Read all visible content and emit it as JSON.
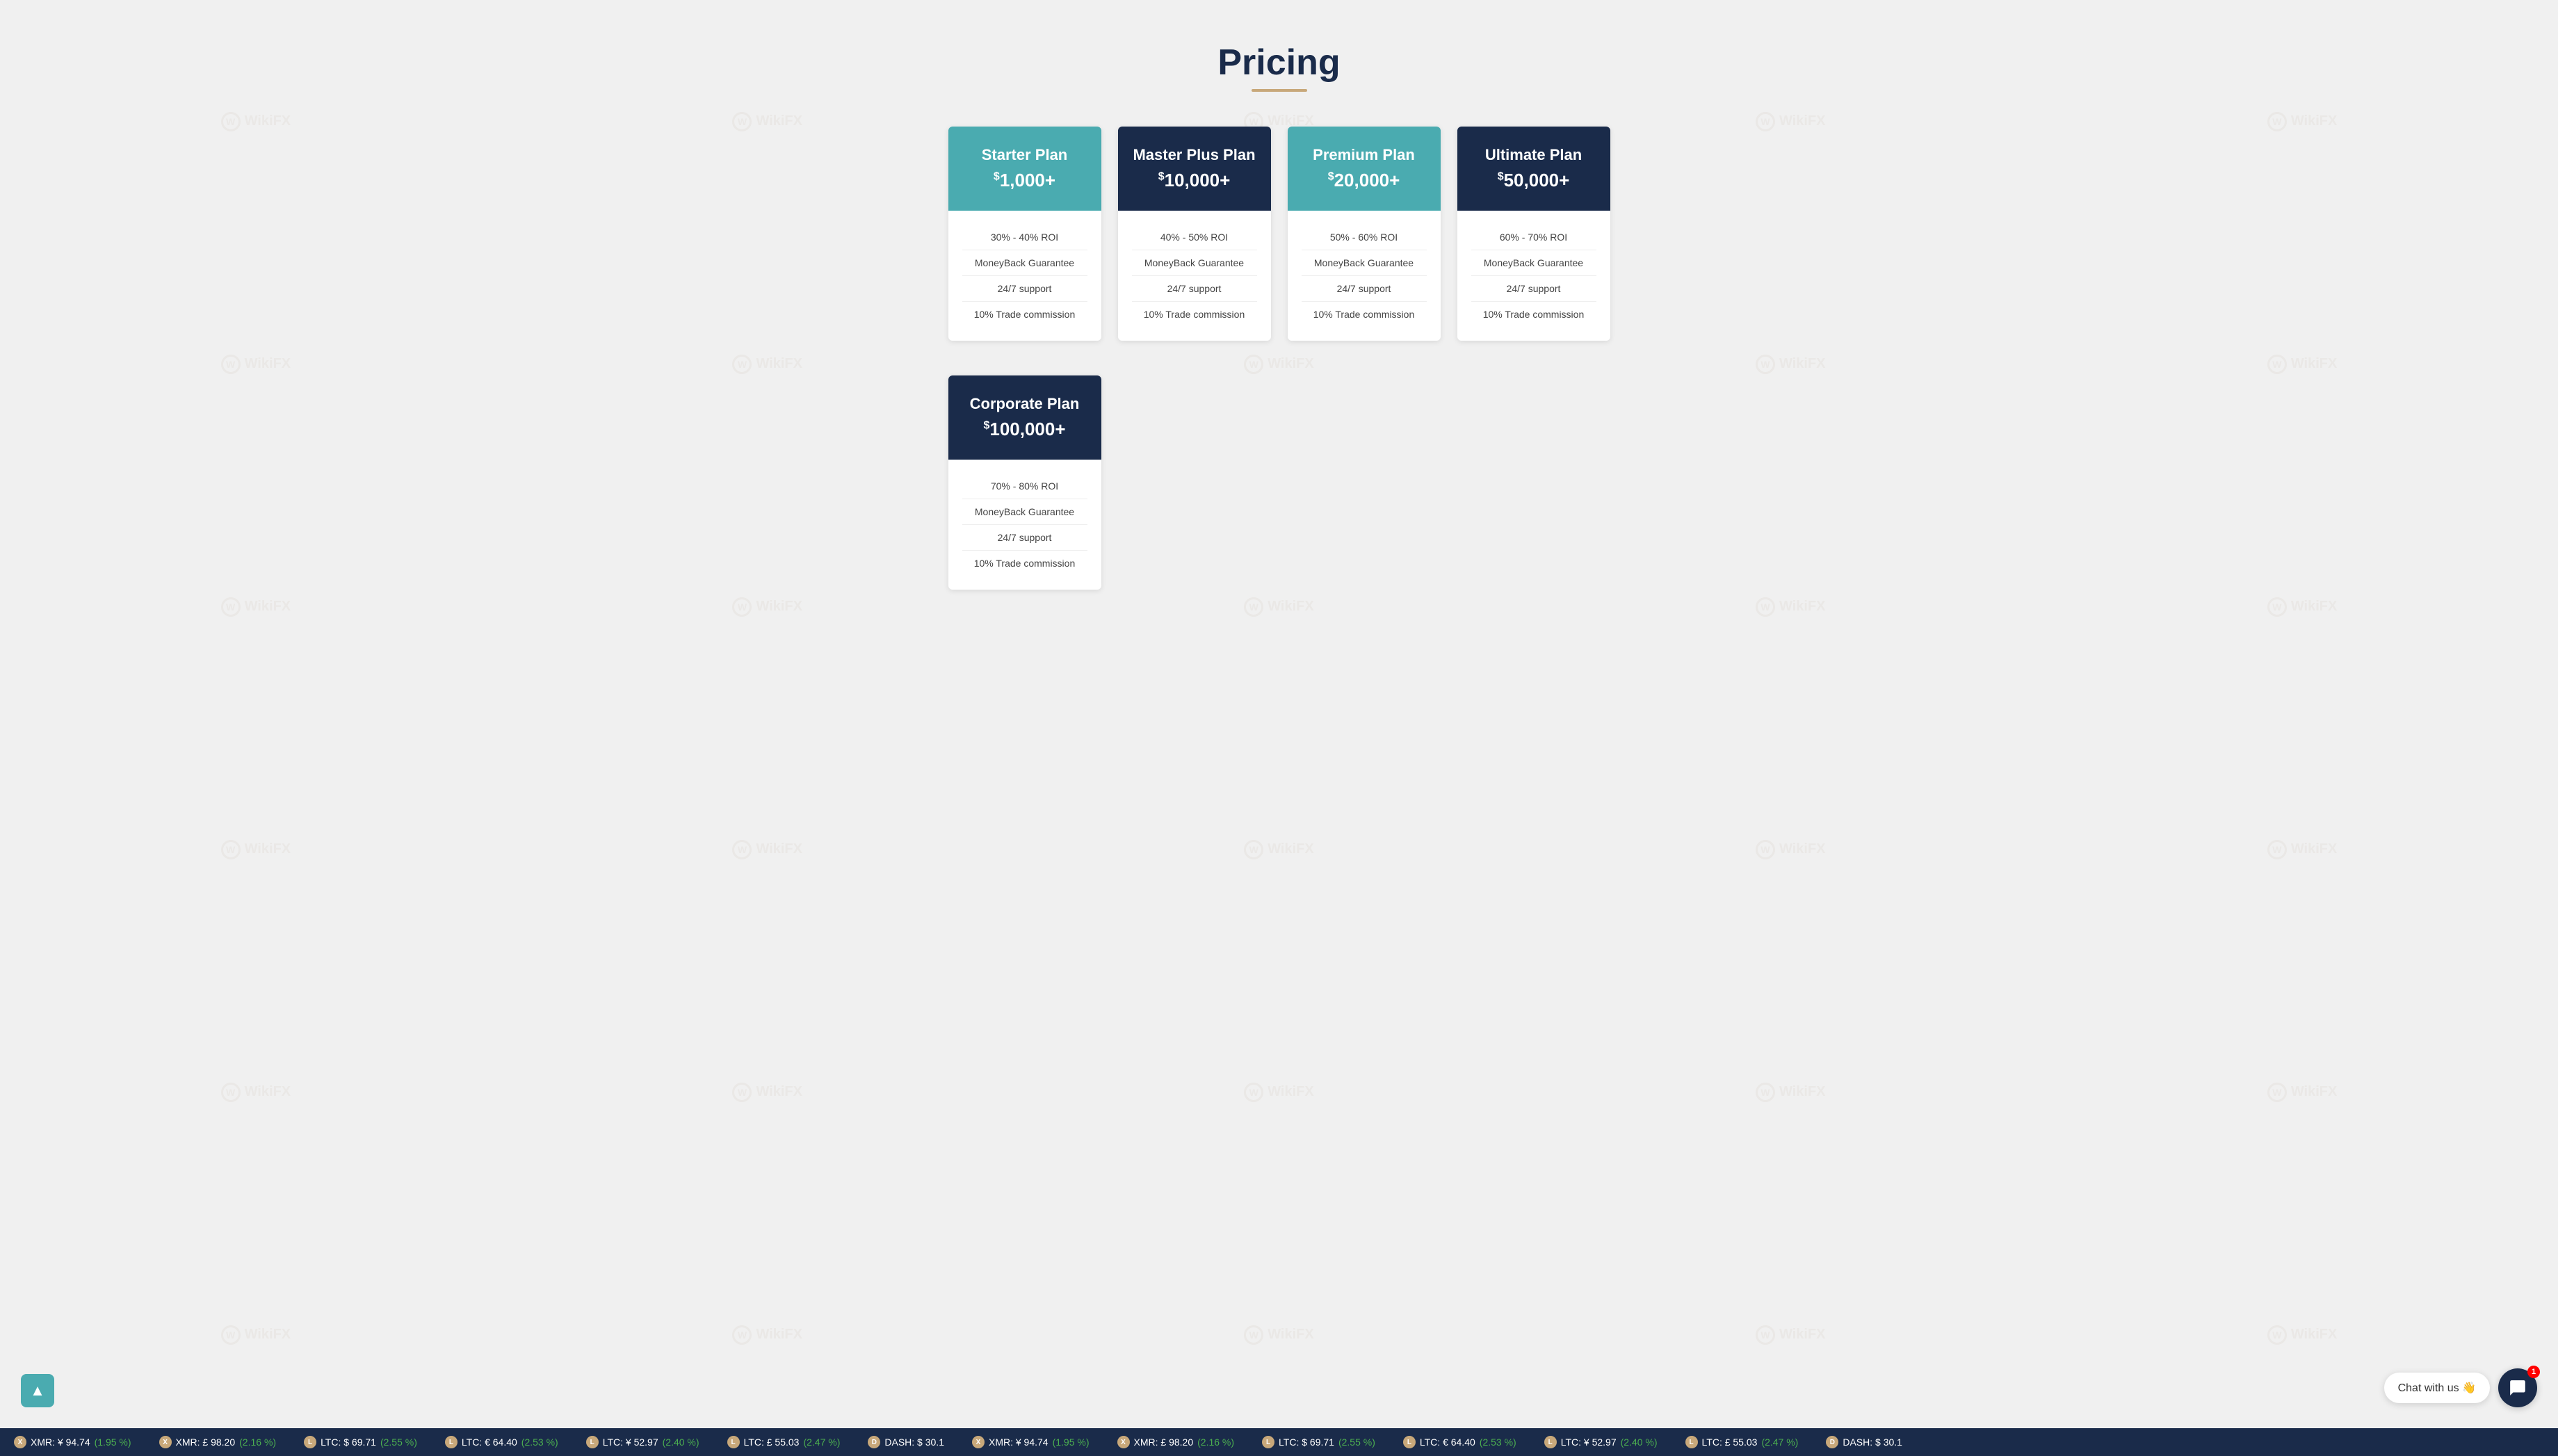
{
  "page": {
    "title": "Pricing",
    "title_underline": true
  },
  "plans": [
    {
      "id": "starter",
      "name": "Starter Plan",
      "price": "1,000+",
      "header_style": "teal",
      "roi": "30% - 40% ROI",
      "money_back": "MoneyBack Guarantee",
      "support": "24/7 support",
      "commission": "10% Trade commission"
    },
    {
      "id": "master-plus",
      "name": "Master Plus Plan",
      "price": "10,000+",
      "header_style": "dark",
      "roi": "40% - 50% ROI",
      "money_back": "MoneyBack Guarantee",
      "support": "24/7 support",
      "commission": "10% Trade commission"
    },
    {
      "id": "premium",
      "name": "Premium Plan",
      "price": "20,000+",
      "header_style": "teal",
      "roi": "50% - 60% ROI",
      "money_back": "MoneyBack Guarantee",
      "support": "24/7 support",
      "commission": "10% Trade commission"
    },
    {
      "id": "ultimate",
      "name": "Ultimate Plan",
      "price": "50,000+",
      "header_style": "dark",
      "roi": "60% - 70% ROI",
      "money_back": "MoneyBack Guarantee",
      "support": "24/7 support",
      "commission": "10% Trade commission"
    }
  ],
  "corporate_plan": {
    "id": "corporate",
    "name": "Corporate Plan",
    "price": "100,000+",
    "header_style": "dark",
    "roi": "70% - 80% ROI",
    "money_back": "MoneyBack Guarantee",
    "support": "24/7 support",
    "commission": "10% Trade commission"
  },
  "chat": {
    "label": "Chat with us 👋",
    "badge": "1"
  },
  "ticker": [
    {
      "coin": "XMR",
      "currency": "¥",
      "value": "94.74",
      "change": "1.95 %",
      "up": true
    },
    {
      "coin": "XMR",
      "currency": "£",
      "value": "98.20",
      "change": "2.16 %",
      "up": true
    },
    {
      "coin": "LTC",
      "currency": "$",
      "value": "69.71",
      "change": "2.55 %",
      "up": true
    },
    {
      "coin": "LTC",
      "currency": "€",
      "value": "64.40",
      "change": "2.53 %",
      "up": true
    },
    {
      "coin": "LTC",
      "currency": "¥",
      "value": "52.97",
      "change": "2.40 %",
      "up": true
    },
    {
      "coin": "LTC",
      "currency": "£",
      "value": "55.03",
      "change": "2.47 %",
      "up": true
    },
    {
      "coin": "DASH",
      "currency": "$",
      "value": "30.1",
      "change": "",
      "up": true
    }
  ],
  "scroll_top": {
    "icon": "▲"
  }
}
